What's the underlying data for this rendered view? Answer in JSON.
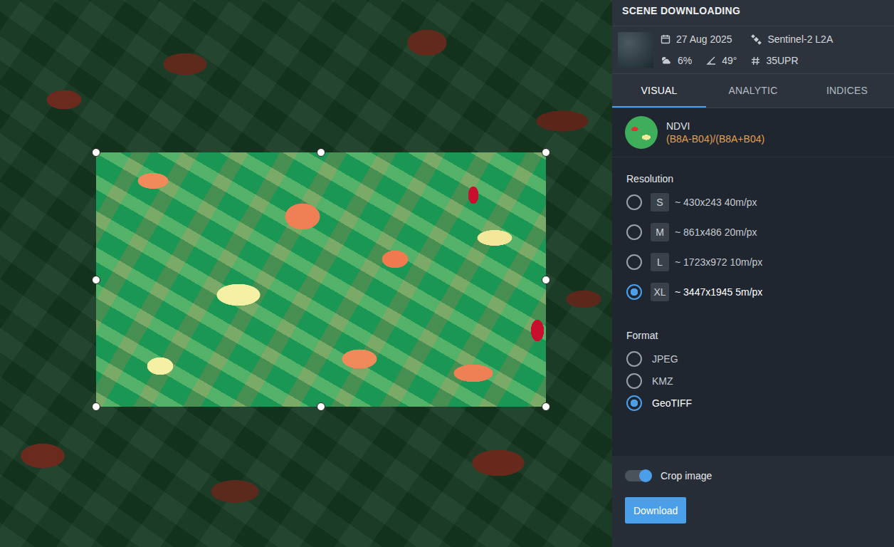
{
  "panel": {
    "title": "SCENE DOWNLOADING"
  },
  "scene": {
    "date": "27 Aug 2025",
    "satellite": "Sentinel-2 L2A",
    "cloud": "6%",
    "angle": "49°",
    "tile": "35UPR"
  },
  "tabs": [
    {
      "label": "VISUAL",
      "selected": true
    },
    {
      "label": "ANALYTIC",
      "selected": false
    },
    {
      "label": "INDICES",
      "selected": false
    }
  ],
  "layer": {
    "name": "NDVI",
    "formula": "(B8A-B04)/(B8A+B04)"
  },
  "resolution": {
    "label": "Resolution",
    "options": [
      {
        "code": "S",
        "text": "~ 430x243 40m/px",
        "selected": false
      },
      {
        "code": "M",
        "text": "~ 861x486 20m/px",
        "selected": false
      },
      {
        "code": "L",
        "text": "~ 1723x972 10m/px",
        "selected": false
      },
      {
        "code": "XL",
        "text": "~ 3447x1945 5m/px",
        "selected": true
      }
    ]
  },
  "format": {
    "label": "Format",
    "options": [
      {
        "text": "JPEG",
        "selected": false
      },
      {
        "text": "KMZ",
        "selected": false
      },
      {
        "text": "GeoTIFF",
        "selected": true
      }
    ]
  },
  "crop": {
    "label": "Crop image",
    "on": true
  },
  "download": {
    "label": "Download"
  }
}
